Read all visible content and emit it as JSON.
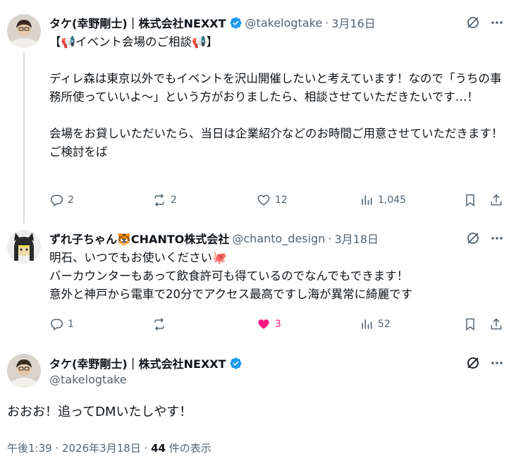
{
  "tweets": [
    {
      "name": "タケ(幸野剛士)｜株式会社NEXXT",
      "handle": "@takelogtake",
      "sep": "·",
      "date": "3月16日",
      "text": "【📢イベント会場のご相談📢】\n\nディレ森は東京以外でもイベントを沢山開催したいと考えています！なので「うちの事務所使っていいよ〜」という方がおりましたら、相談させていただきたいです…！\n\n会場をお貸しいただいたら、当日は企業紹介などのお時間ご用意させていただきます！ご検討をば",
      "replies": "2",
      "reposts": "2",
      "likes": "12",
      "views": "1,045"
    },
    {
      "name": "ずれ子ちゃん🐯CHANTO株式会社",
      "handle": "@chanto_design",
      "sep": "·",
      "date": "3月18日",
      "text": "明石、いつでもお使いください🐙\nバーカウンターもあって飲食許可も得ているのでなんでもできます！\n意外と神戸から電車で20分でアクセス最高ですし海が異常に綺麗です",
      "replies": "1",
      "reposts": "",
      "likes": "3",
      "views": "52"
    }
  ],
  "main": {
    "name": "タケ(幸野剛士)｜株式会社NEXXT",
    "handle": "@takelogtake",
    "text": "おおお！追ってDMいたしやす！",
    "time": "午後1:39 · 2026年3月18日 · ",
    "views_count": "44",
    "views_label": " 件の表示"
  },
  "colors": {
    "text": "#0f1419",
    "muted": "#536471",
    "verified": "#1d9bf0",
    "like_active": "#f91880",
    "thread_line": "#cfd9de"
  }
}
